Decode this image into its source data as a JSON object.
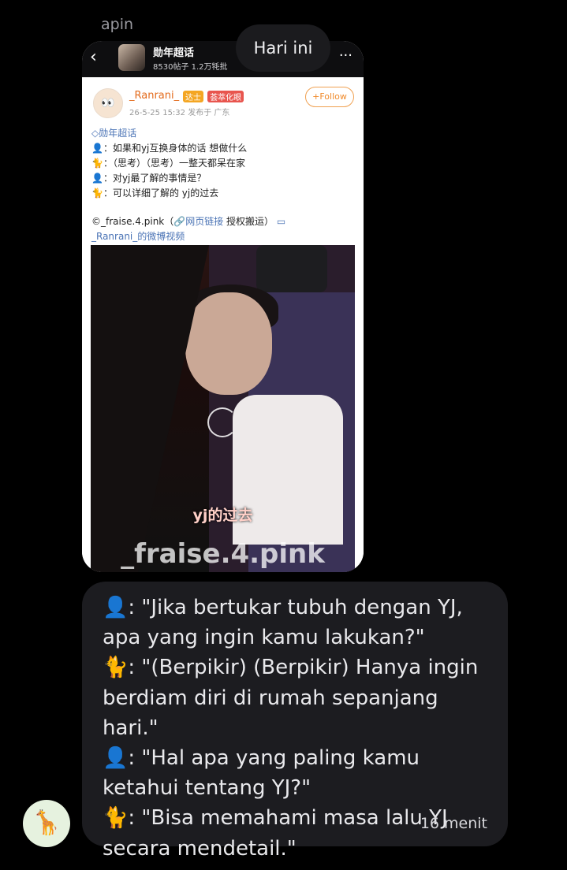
{
  "chat": {
    "sender_name": "apin",
    "date_pill": "Hari ini"
  },
  "image_message": {
    "weibo_header": {
      "back_icon": "back-arrow-icon",
      "title": "勋年超话",
      "subtitle": "8530帖子 1.2万牦批",
      "more_icon": "more-icon"
    },
    "post": {
      "username": "_Ranrani_",
      "badges": [
        "达士",
        "荟萃化眼"
      ],
      "meta": "26-5-25 15:32  发布于 广东",
      "follow_label": "+Follow",
      "topic": "勋年超话",
      "lines": [
        "👤：如果和yj互换身体的话 想做什么",
        "🐈：（思考）（思考）一整天都呆在家",
        "👤：对yj最了解的事情是？",
        "🐈：可以详细了解的 yj的过去"
      ],
      "source_line1_a": "©_fraise.4.pink（",
      "source_link": "网页链接",
      "source_line1_b": " 授权搬运）",
      "source_line2": "_Ranrani_的微博视频",
      "video_subtitle": "yj的过去",
      "video_watermark": "_fraise.4.pink"
    }
  },
  "text_message": {
    "body": "👤: \"Jika bertukar tubuh dengan YJ,\napa yang ingin kamu lakukan?\"\n🐈: \"(Berpikir) (Berpikir) Hanya ingin\nberdiam diri di rumah sepanjang hari.\"\n👤: \"Hal apa yang paling kamu\nketahui tentang YJ?\"\n🐈: \"Bisa memahami masa lalu YJ\nsecara mendetail.\"",
    "time": "16 menit"
  },
  "avatar_icon": "giraffe-icon"
}
